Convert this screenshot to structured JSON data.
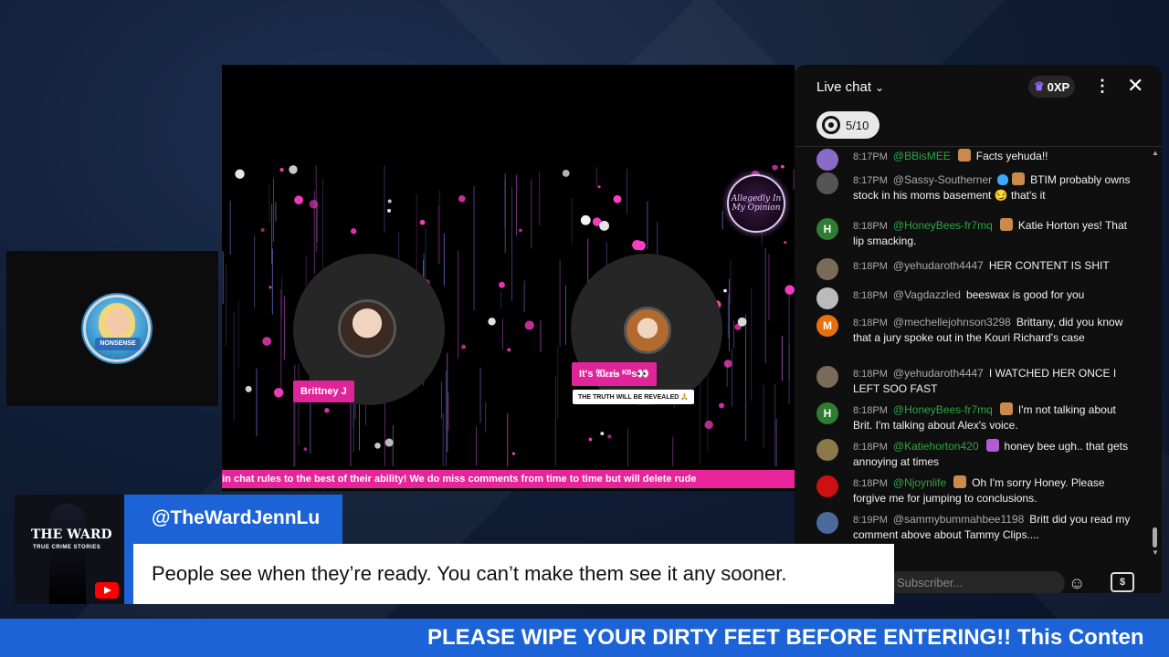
{
  "stage": {
    "hosts": [
      {
        "name": "Brittney J"
      },
      {
        "name": "It's 𝔄𝔩𝔢𝔵𝔦𝔰 ᴷᴮs👀",
        "subtitle": "THE TRUTH WILL BE REVEALED 🙏"
      }
    ],
    "logo_text": "Allegedly In My Opinion",
    "ticker": "ain chat rules to the best of their ability! We do miss comments from time to time but will delete rude"
  },
  "guest_tile": {
    "badge": "NONSENSE"
  },
  "chat": {
    "title": "Live chat",
    "xp": "0XP",
    "goal": "5/10",
    "input_placeholder": "Subscriber...",
    "messages": [
      {
        "time": "8:17PM",
        "author": "@BBisMEE",
        "member": true,
        "text": "Facts yehuda!!",
        "avatar": "",
        "avatar_color": "#8a6bc8",
        "emoji_color": "#c98a4b"
      },
      {
        "time": "8:17PM",
        "author": "@Sassy-Southerner",
        "member": false,
        "verified": true,
        "text": "BTIM probably owns stock in his moms basement 😏 that's it",
        "avatar": "",
        "avatar_color": "#555555",
        "emoji_color": "#c98a4b"
      },
      {
        "time": "8:18PM",
        "author": "@HoneyBees-fr7mq",
        "member": true,
        "text": "Katie Horton yes! That lip smacking.",
        "avatar": "H",
        "avatar_color": "#2e7d32",
        "emoji_color": "#c98a4b"
      },
      {
        "time": "8:18PM",
        "author": "@yehudaroth4447",
        "member": false,
        "text": "HER CONTENT IS SHIT",
        "avatar": "",
        "avatar_color": "#7a6a5a"
      },
      {
        "time": "8:18PM",
        "author": "@Vagdazzled",
        "member": false,
        "text": "beeswax is good for you",
        "avatar": "",
        "avatar_color": "#bbbbbb"
      },
      {
        "time": "8:18PM",
        "author": "@mechellejohnson3298",
        "member": false,
        "text": "Brittany, did you know that a jury spoke out in the Kouri Richard's case",
        "avatar": "M",
        "avatar_color": "#e8710a"
      },
      {
        "time": "8:18PM",
        "author": "@yehudaroth4447",
        "member": false,
        "text": "I WATCHED HER ONCE I LEFT SOO FAST",
        "avatar": "",
        "avatar_color": "#7a6a5a"
      },
      {
        "time": "8:18PM",
        "author": "@HoneyBees-fr7mq",
        "member": true,
        "text": "I'm not talking about Brit. I'm talking about Alex's voice.",
        "avatar": "H",
        "avatar_color": "#2e7d32",
        "emoji_color": "#c98a4b"
      },
      {
        "time": "8:18PM",
        "author": "@Katiehorton420",
        "member": true,
        "text": "honey bee ugh.. that gets annoying at times",
        "avatar": "",
        "avatar_color": "#8a7a4a",
        "emoji_color": "#b45ad6"
      },
      {
        "time": "8:18PM",
        "author": "@Njoynlife",
        "member": true,
        "text": "Oh I'm sorry Honey. Please forgive me for jumping to conclusions.",
        "avatar": "",
        "avatar_color": "#cc1111",
        "emoji_color": "#c98a4b"
      },
      {
        "time": "8:19PM",
        "author": "@sammybummahbee1198",
        "member": false,
        "text": "Britt did you read my comment above about Tammy Clips....",
        "avatar": "",
        "avatar_color": "#4a6a9a"
      }
    ]
  },
  "lower_third": {
    "channel_title": "THE WARD",
    "channel_subtitle": "TRUE CRIME STORIES",
    "handle": "@TheWardJennLu",
    "quote": "People see when they’re ready. You can’t make them see it any sooner."
  },
  "bottom_ticker": "PLEASE WIPE YOUR DIRTY FEET BEFORE ENTERING!! This Conten",
  "colors": {
    "accent_blue": "#1b63d6",
    "accent_pink": "#e0249a",
    "member_green": "#2ba640"
  }
}
